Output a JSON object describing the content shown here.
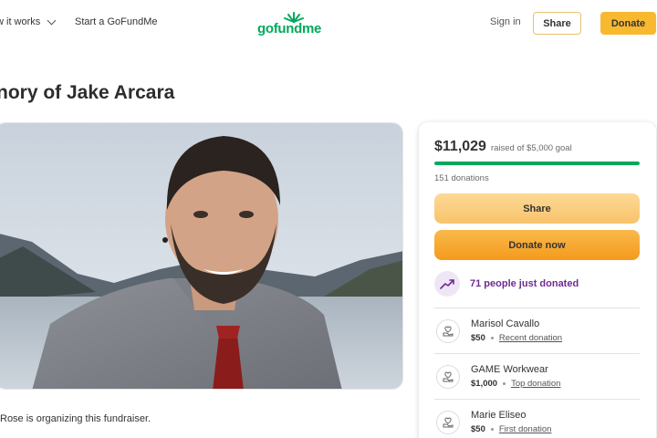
{
  "header": {
    "how_it_works": "w it works",
    "start": "Start a GoFundMe",
    "logo_text": "gofundme",
    "sign_in": "Sign in",
    "share": "Share",
    "donate": "Donate"
  },
  "campaign": {
    "title": "nory of Jake Arcara",
    "organizer_text": "Rose is organizing this fundraiser."
  },
  "card": {
    "raised_amount": "$11,029",
    "raised_label": "raised of $5,000 goal",
    "progress_fraction": 1.0,
    "donations_count": "151 donations",
    "share_label": "Share",
    "donate_label": "Donate now",
    "just_donated": "71 people just donated",
    "donors": [
      {
        "name": "Marisol Cavallo",
        "amount": "$50",
        "tag": "Recent donation"
      },
      {
        "name": "GAME Workwear",
        "amount": "$1,000",
        "tag": "Top donation"
      },
      {
        "name": "Marie Eliseo",
        "amount": "$50",
        "tag": "First donation"
      }
    ]
  },
  "colors": {
    "brand_green": "#02a95c",
    "donate_yellow": "#f8b931",
    "donate_orange": "#f49a1d",
    "purple": "#6f2c91"
  }
}
